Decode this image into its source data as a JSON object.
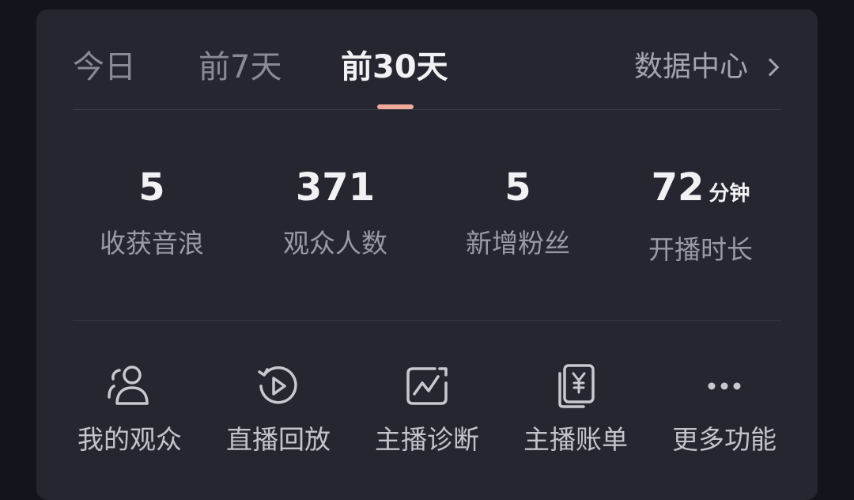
{
  "tabs": [
    {
      "label": "今日"
    },
    {
      "label": "前7天"
    },
    {
      "label": "前30天"
    }
  ],
  "active_tab": "前30天",
  "data_center": {
    "label": "数据中心"
  },
  "stats": [
    {
      "value": "5",
      "unit": "",
      "label": "收获音浪"
    },
    {
      "value": "371",
      "unit": "",
      "label": "观众人数"
    },
    {
      "value": "5",
      "unit": "",
      "label": "新增粉丝"
    },
    {
      "value": "72",
      "unit": "分钟",
      "label": "开播时长"
    }
  ],
  "actions": [
    {
      "icon": "audience-icon",
      "label": "我的观众"
    },
    {
      "icon": "replay-icon",
      "label": "直播回放"
    },
    {
      "icon": "diagnosis-icon",
      "label": "主播诊断"
    },
    {
      "icon": "bill-icon",
      "label": "主播账单"
    },
    {
      "icon": "more-icon",
      "label": "更多功能"
    }
  ],
  "colors": {
    "background": "#14141c",
    "card": "#262630",
    "accent": "#f1a99d"
  }
}
